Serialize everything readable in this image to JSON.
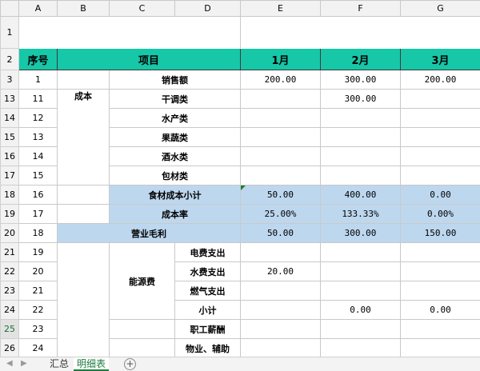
{
  "columns": [
    "A",
    "B",
    "C",
    "D",
    "E",
    "F",
    "G"
  ],
  "header": {
    "seq": "序号",
    "item": "项目",
    "m1": "1月",
    "m2": "2月",
    "m3": "3月"
  },
  "rows": {
    "r1": "1",
    "r2": "2",
    "r3": {
      "rownum": "3",
      "seq": "1",
      "label": "销售额",
      "m1": "200.00",
      "m2": "300.00",
      "m3": "200.00"
    },
    "cost_category": "成本",
    "r13": {
      "rownum": "13",
      "seq": "11",
      "label": "干调类",
      "m1": "",
      "m2": "300.00",
      "m3": ""
    },
    "r14": {
      "rownum": "14",
      "seq": "12",
      "label": "水产类"
    },
    "r15": {
      "rownum": "15",
      "seq": "13",
      "label": "果蔬类"
    },
    "r16": {
      "rownum": "16",
      "seq": "14",
      "label": "酒水类"
    },
    "r17": {
      "rownum": "17",
      "seq": "15",
      "label": "包材类"
    },
    "r18": {
      "rownum": "18",
      "seq": "16",
      "label": "食材成本小计",
      "m1": "50.00",
      "m2": "400.00",
      "m3": "0.00"
    },
    "r19": {
      "rownum": "19",
      "seq": "17",
      "label": "成本率",
      "m1": "25.00%",
      "m2": "133.33%",
      "m3": "0.00%"
    },
    "r20": {
      "rownum": "20",
      "seq": "18",
      "label": "营业毛利",
      "m1": "50.00",
      "m2": "300.00",
      "m3": "150.00"
    },
    "energy_category": "能源费",
    "r21": {
      "rownum": "21",
      "seq": "19",
      "label": "电费支出"
    },
    "r22": {
      "rownum": "22",
      "seq": "20",
      "label": "水费支出",
      "m1": "20.00"
    },
    "r23": {
      "rownum": "23",
      "seq": "21",
      "label": "燃气支出"
    },
    "r24": {
      "rownum": "24",
      "seq": "22",
      "label": "小计",
      "m2": "0.00",
      "m3": "0.00"
    },
    "r25": {
      "rownum": "25",
      "seq": "23",
      "label": "职工薪酬"
    },
    "r26": {
      "rownum": "26",
      "seq": "24",
      "label": "物业、辅助"
    }
  },
  "tabs": {
    "nav_prev": "◀",
    "nav_next": "▶",
    "sheet1": "汇总",
    "sheet2": "明细表",
    "add": "+"
  }
}
